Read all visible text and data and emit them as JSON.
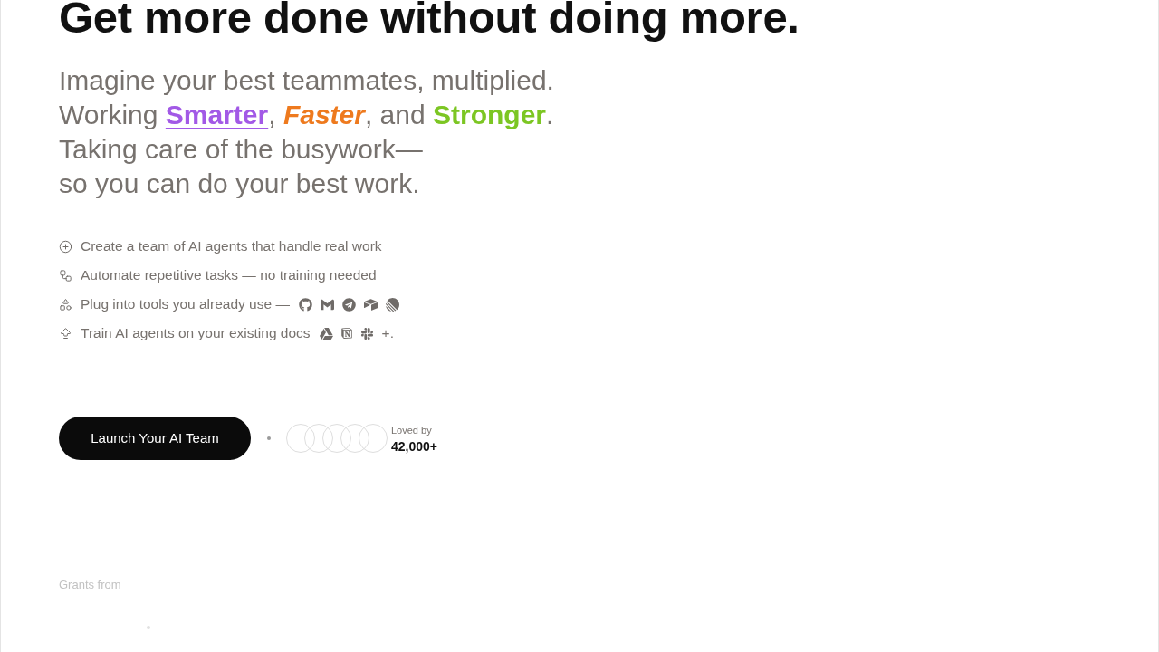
{
  "heading": "Get more done without doing more.",
  "subtitle": {
    "lines": [
      [
        {
          "kind": "plain",
          "text": "Imagine your best teammates, multiplied."
        }
      ],
      [
        {
          "kind": "plain",
          "text": "Working "
        },
        {
          "kind": "link",
          "text": "Smarter",
          "color": "#a259e6"
        },
        {
          "kind": "plain",
          "text": ", "
        },
        {
          "kind": "italic",
          "text": "Faster",
          "color": "#ee7a1e"
        },
        {
          "kind": "plain",
          "text": ", and "
        },
        {
          "kind": "bold",
          "text": "Stronger",
          "color": "#7cc623"
        },
        {
          "kind": "plain",
          "text": "."
        }
      ],
      [
        {
          "kind": "plain",
          "text": "Taking care of the busywork—"
        }
      ],
      [
        {
          "kind": "plain",
          "text": "so you can do your best work."
        }
      ]
    ]
  },
  "features": [
    {
      "text": "Create a team of AI agents that handle real work"
    },
    {
      "text": "Automate repetitive tasks — no training needed"
    },
    {
      "text": "Plug into tools you already use —"
    },
    {
      "text": "Train AI agents on your existing docs",
      "suffix": "+."
    }
  ],
  "cta": {
    "label": "Launch Your AI Team"
  },
  "social_proof": {
    "label": "Loved by",
    "count": "42,000+"
  },
  "grants": {
    "label": "Grants from"
  }
}
